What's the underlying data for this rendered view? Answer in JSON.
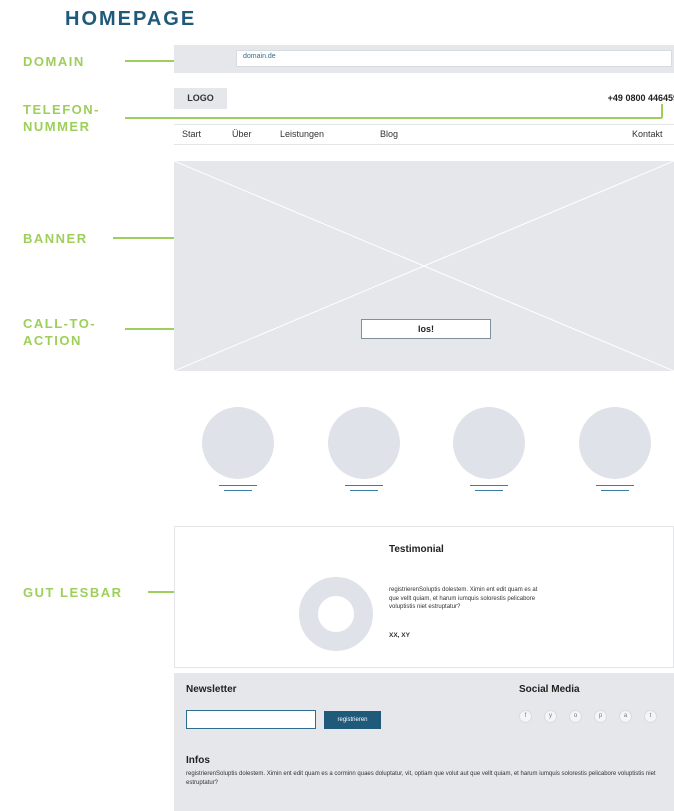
{
  "title": "HOMEPAGE",
  "annotations": {
    "domain": "DOMAIN",
    "telefon_line1": "TELEFON-",
    "telefon_line2": "NUMMER",
    "banner": "BANNER",
    "cta_line1": "CALL-TO-",
    "cta_line2": "ACTION",
    "gut_lesbar": "GUT LESBAR"
  },
  "wireframe": {
    "url": "domain.de",
    "logo": "LOGO",
    "phone": "+49 0800 446459",
    "nav": [
      "Start",
      "Über",
      "Leistungen",
      "Blog",
      "Kontakt"
    ],
    "cta_label": "los!",
    "testimonial": {
      "title": "Testimonial",
      "text": "registrierenSoluptis dolestem. Ximin ent edit quam es at que vellt quiam, et harum iumquis solorestis pelicabore voluptistis niet estruptatur?",
      "author": "XX, XY"
    },
    "footer": {
      "newsletter_title": "Newsletter",
      "newsletter_button": "registrieren",
      "social_title": "Social Media",
      "social_icons": [
        "f",
        "y",
        "o",
        "p",
        "a",
        "t"
      ],
      "infos_title": "Infos",
      "infos_text": "registrierenSoluptis dolestem. Ximin ent edit quam es a corminn quaes doluptatur, vit, optiam que volut aut que vellt quiam, et harum iumquis solorestis pelicabore voluptistis niet estruptatur?"
    }
  },
  "colors": {
    "annotation": "#9dcf5a",
    "title": "#1f5a7a",
    "wireframe_grey": "#e5e7ea"
  }
}
